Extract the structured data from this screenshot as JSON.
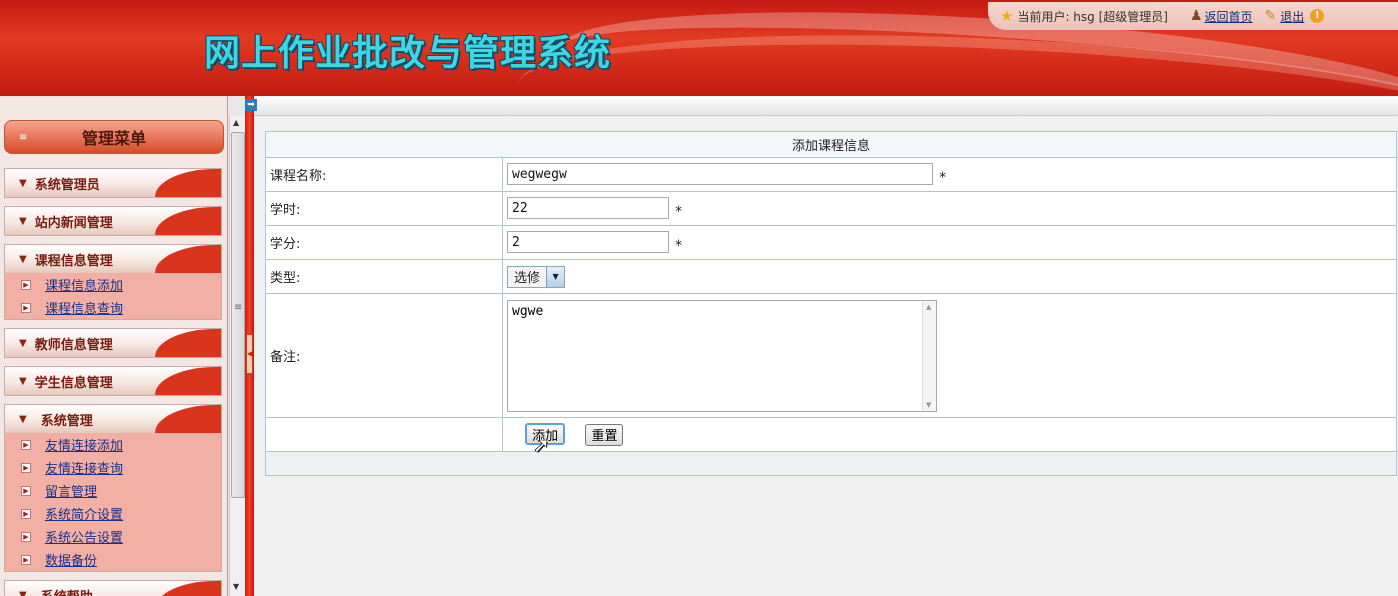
{
  "header": {
    "title": "网上作业批改与管理系统",
    "current_user_label": "当前用户: hsg [超级管理员]",
    "home_link": "返回首页",
    "logout_link": "退出"
  },
  "sidebar": {
    "menu_title": "管理菜单",
    "groups": [
      {
        "title": "系统管理员",
        "items": []
      },
      {
        "title": "站内新闻管理",
        "items": []
      },
      {
        "title": "课程信息管理",
        "items": [
          "课程信息添加",
          "课程信息查询"
        ]
      },
      {
        "title": "教师信息管理",
        "items": []
      },
      {
        "title": "学生信息管理",
        "items": []
      },
      {
        "title": "系统管理",
        "items": [
          "友情连接添加",
          "友情连接查询",
          "留言管理",
          "系统简介设置",
          "系统公告设置",
          "数据备份"
        ]
      },
      {
        "title": "系统帮助",
        "items": []
      }
    ]
  },
  "form": {
    "caption": "添加课程信息",
    "name_label": "课程名称:",
    "name_value": "wegwegw",
    "hours_label": "学时:",
    "hours_value": "22",
    "credits_label": "学分:",
    "credits_value": "2",
    "type_label": "类型:",
    "type_value": "选修",
    "remark_label": "备注:",
    "remark_value": "wgwe",
    "required_mark": "*",
    "add_button": "添加",
    "reset_button": "重置"
  }
}
